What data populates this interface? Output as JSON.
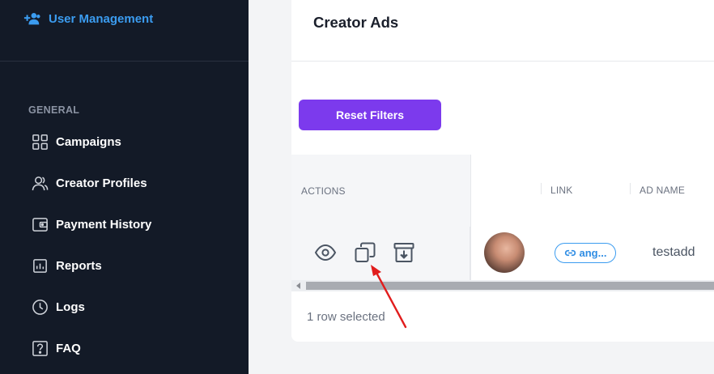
{
  "sidebar": {
    "top_item": {
      "label": "User Management",
      "icon": "add-user-icon",
      "color": "#3b9cf0"
    },
    "section_label": "GENERAL",
    "items": [
      {
        "label": "Campaigns",
        "icon": "grid-icon"
      },
      {
        "label": "Creator Profiles",
        "icon": "users-icon"
      },
      {
        "label": "Payment History",
        "icon": "wallet-icon"
      },
      {
        "label": "Reports",
        "icon": "chart-icon"
      },
      {
        "label": "Logs",
        "icon": "clock-icon"
      },
      {
        "label": "FAQ",
        "icon": "question-icon"
      }
    ]
  },
  "main": {
    "title": "Creator Ads",
    "reset_filters_label": "Reset Filters",
    "table": {
      "headers": {
        "actions": "ACTIONS",
        "link": "LINK",
        "ad_name": "AD NAME"
      },
      "rows": [
        {
          "actions": [
            "eye-icon",
            "copy-icon",
            "archive-icon"
          ],
          "avatar": "avatar",
          "link_label": "ang...",
          "ad_name": "testadd"
        }
      ]
    },
    "footer": {
      "selected_text": "1 row selected"
    }
  },
  "colors": {
    "sidebar_bg": "#131a27",
    "accent_purple": "#7c3aed",
    "link_blue": "#3b9cf0",
    "annotation_red": "#e11d1d"
  }
}
